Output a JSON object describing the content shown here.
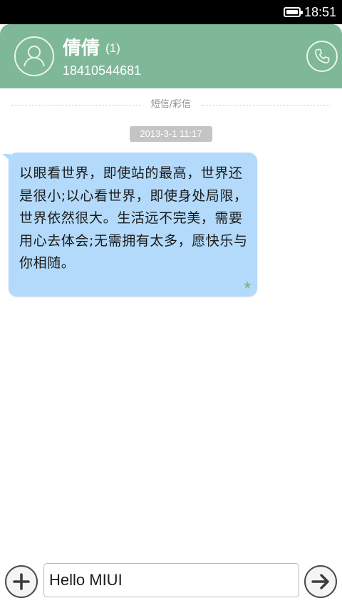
{
  "status_bar": {
    "time": "18:51",
    "battery_icon": "battery-full-icon"
  },
  "header": {
    "contact_name": "倩倩",
    "unread_count": "(1)",
    "phone_number": "18410544681",
    "avatar_icon": "person-icon",
    "call_icon": "phone-icon",
    "color": "#7eb898"
  },
  "conversation": {
    "divider_label": "短信/彩信",
    "messages": [
      {
        "timestamp": "2013-3-1 11:17",
        "text": "以眼看世界，即使站的最高，世界还是很小;以心看世界，即使身处局限，世界依然很大。生活远不完美，需要用心去体会;无需拥有太多，愿快乐与你相随。",
        "starred_icon": "star-icon",
        "bubble_color": "#b3dafa"
      }
    ]
  },
  "composer": {
    "input_value": "Hello MIUI",
    "attach_icon": "plus-icon",
    "send_icon": "arrow-right-icon"
  }
}
